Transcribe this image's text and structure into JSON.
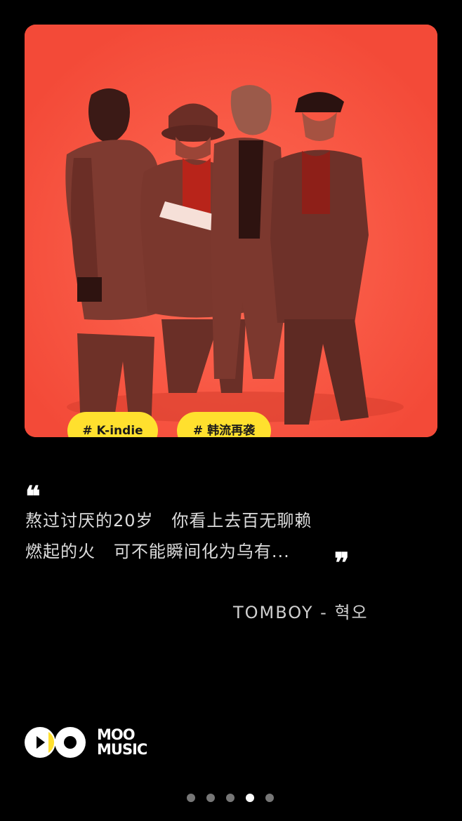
{
  "colors": {
    "background": "#000000",
    "card": "#F8533F",
    "tag": "#FFE02E",
    "tag_text": "#1a1a1a",
    "lyric": "#dcdcdc",
    "dot_inactive": "#777777",
    "dot_active": "#ffffff"
  },
  "card": {
    "image_alt": "band photo",
    "tags": [
      {
        "label": "# K-indie"
      },
      {
        "label": "# 韩流再袭"
      }
    ]
  },
  "quote": {
    "open_icon": "quote-open-icon",
    "close_icon": "quote-close-icon",
    "lines": [
      "熬过讨厌的20岁   你看上去百无聊赖",
      "燃起的火   可不能瞬间化为乌有..."
    ],
    "credit": "TOMBOY - 혁오"
  },
  "brand": {
    "logo_icon": "moo-music-logo-icon",
    "line1": "MOO",
    "line2": "MUSIC"
  },
  "pagination": {
    "count": 5,
    "active_index": 3
  }
}
